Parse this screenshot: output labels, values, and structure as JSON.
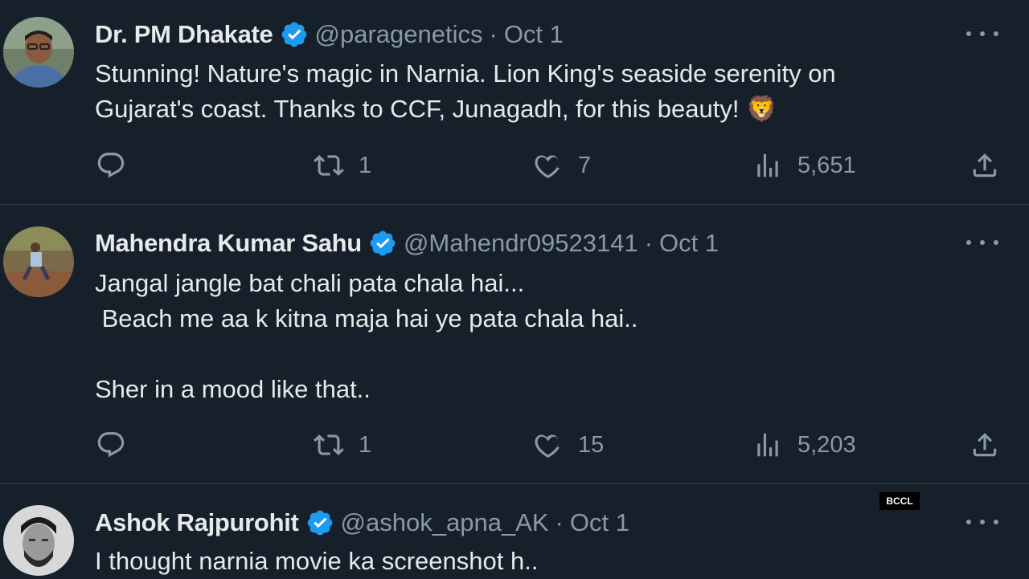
{
  "tweets": [
    {
      "name": "Dr. PM Dhakate",
      "handle": "@paragenetics",
      "separator": "·",
      "date": "Oct 1",
      "text": "Stunning! Nature's magic in Narnia. Lion King's seaside serenity on\nGujarat's coast. Thanks to CCF, Junagadh, for this beauty! 🦁",
      "replies": "",
      "retweets": "1",
      "likes": "7",
      "views": "5,651"
    },
    {
      "name": "Mahendra Kumar Sahu",
      "handle": "@Mahendr09523141",
      "separator": "·",
      "date": "Oct 1",
      "text": "Jangal jangle bat chali pata chala hai...\n Beach me aa k kitna maja hai ye pata chala hai..\n\nSher in a mood like that..",
      "replies": "",
      "retweets": "1",
      "likes": "15",
      "views": "5,203"
    },
    {
      "name": "Ashok Rajpurohit",
      "handle": "@ashok_apna_AK",
      "separator": "·",
      "date": "Oct 1",
      "text": "I thought narnia movie ka screenshot h..",
      "replies": "",
      "retweets": "",
      "likes": "",
      "views": ""
    }
  ],
  "watermark": "BCCL",
  "colors": {
    "background": "#15202b",
    "text": "#e7e9ea",
    "secondary": "#8b98a5",
    "verified": "#1d9bf0",
    "divider": "#38444d"
  },
  "icons": {
    "reply": "speech-bubble-outline",
    "retweet": "retweet-arrows",
    "like": "heart-outline",
    "views": "bar-chart",
    "share": "upload-arrow",
    "more": "three-dots",
    "verified": "verified-badge"
  }
}
